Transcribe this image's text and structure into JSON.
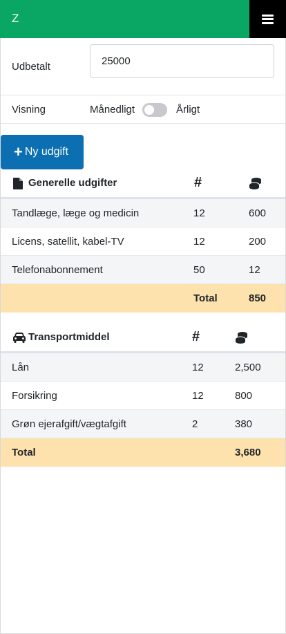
{
  "app": {
    "brand": "Z"
  },
  "form": {
    "paid_label": "Udbetalt",
    "paid_value": "25000",
    "view_label": "Visning",
    "monthly_label": "Månedligt",
    "yearly_label": "Årligt",
    "yearly_on": false
  },
  "add_button": {
    "label": "Ny udgift"
  },
  "sections": [
    {
      "title": "Generelle udgifter",
      "count_header": "#",
      "icon": "file-icon",
      "rows": [
        {
          "name": "Tandlæge, læge og medicin",
          "count": "12",
          "amount": "600"
        },
        {
          "name": "Licens, satellit, kabel-TV",
          "count": "12",
          "amount": "200"
        },
        {
          "name": "Telefonabonnement",
          "count": "50",
          "amount": "12"
        }
      ],
      "total_label": "Total",
      "total_value": "850"
    },
    {
      "title": "Transportmiddel",
      "count_header": "#",
      "icon": "car-icon",
      "rows": [
        {
          "name": "Lån",
          "count": "12",
          "amount": "2,500"
        },
        {
          "name": "Forsikring",
          "count": "12",
          "amount": "800"
        },
        {
          "name": "Grøn ejerafgift/vægtafgift",
          "count": "2",
          "amount": "380"
        }
      ],
      "total_label": "Total",
      "total_value": "3,680"
    }
  ],
  "colors": {
    "navbar": "#0aa764",
    "button": "#0b6fb1",
    "total_row": "#fde2ae"
  }
}
